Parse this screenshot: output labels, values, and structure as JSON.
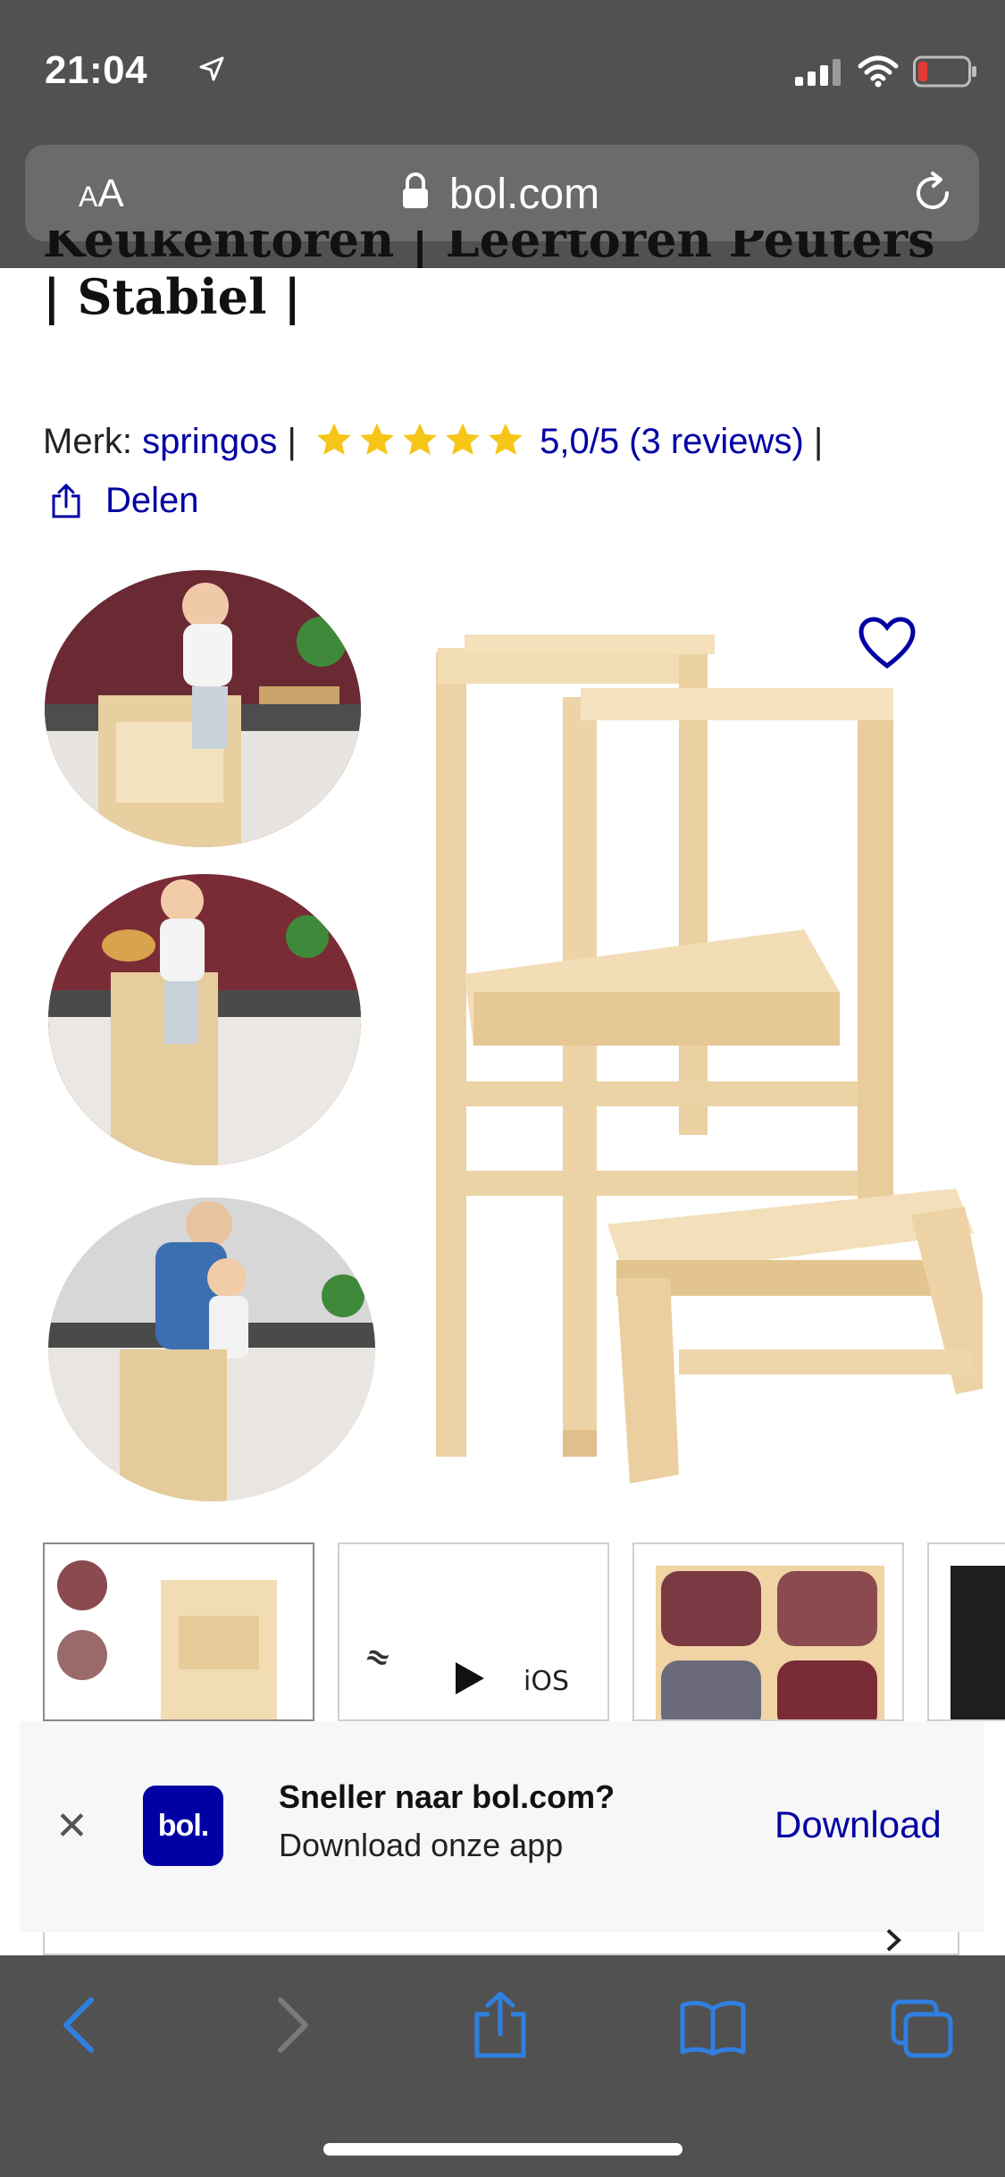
{
  "status_bar": {
    "time": "21:04"
  },
  "browser": {
    "text_size_label_small": "A",
    "text_size_label_large": "A",
    "url": "bol.com"
  },
  "product": {
    "title_line_cut": "Keukentoren | Leertoren Peuters",
    "title_line_2": "| Stabiel |",
    "brand_label": "Merk:",
    "brand_name": "springos",
    "separator": "|",
    "rating_stars": 5,
    "rating_text": "5,0/5 (3 reviews)",
    "share_label": "Delen",
    "strip_video_label": "iOS"
  },
  "app_banner": {
    "close_label": "✕",
    "logo_text": "bol.",
    "title": "Sneller naar bol.com?",
    "subtitle": "Download onze app",
    "cta": "Download"
  },
  "colors": {
    "link_blue": "#0000a4",
    "star_yellow": "#f5c518",
    "chrome_gray": "#515151",
    "toolbar_icon_blue": "#2f7fe0"
  }
}
